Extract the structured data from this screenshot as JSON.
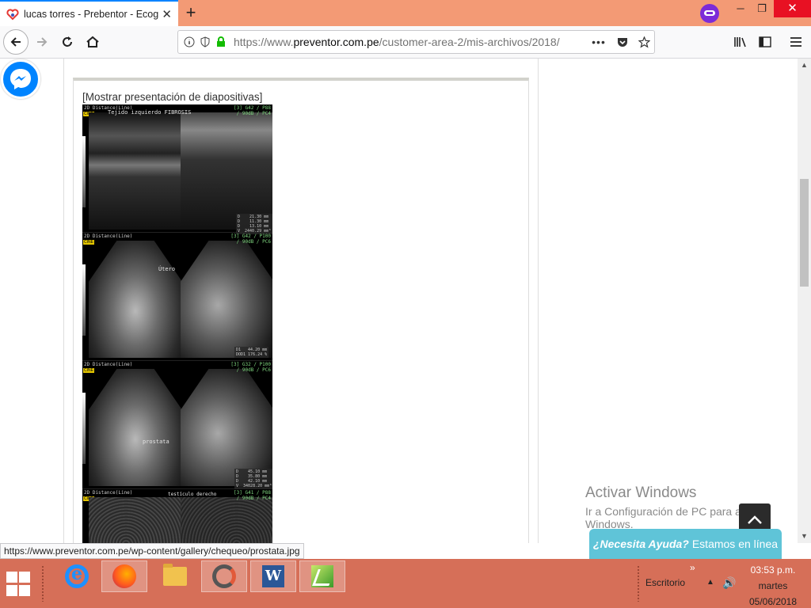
{
  "browser": {
    "tab": {
      "title": "lucas torres - Prebentor - Ecogr"
    },
    "url": {
      "prefix": "https://www.",
      "host": "preventor.com.pe",
      "path": "/customer-area-2/mis-archivos/2018/"
    },
    "window": {
      "minimize": "─",
      "restore": "❐",
      "close": "✕"
    }
  },
  "page": {
    "slideshow_link": "[Mostrar presentación de diapositivas]",
    "ultrasound": {
      "panels": [
        {
          "header": "2D Distance(Line)",
          "label": "Tejido izquierdo FIBROSIS",
          "mode": "[3] G42 / P88\n/ 90dB / PC4",
          "meas": "D    21.30 mm\nD    11.30 mm\nD    13.10 mm\nV  2440.29 mm³"
        },
        {
          "header": "2D Distance(Line)",
          "label": "Útero",
          "mode": "[3] G42 / P100\n/ 90dB / PC6",
          "meas": "D1   44.20 mm\nDOD1 176.24 %"
        },
        {
          "header": "2D Distance(Line)",
          "label": "prostata",
          "mode": "[3] G32 / P100\n/ 90dB / PC6",
          "meas": "D    45.10 mm\nD    35.80 mm\nD    42.10 mm\nV  34028.20 mm³"
        },
        {
          "header": "2D Distance(Line)",
          "label": "testículo derecho",
          "mode": "[3] G41 / P88\n/ 90dB / PC4",
          "meas": ""
        }
      ],
      "cine_label": "CINE"
    },
    "activate_windows": {
      "title": "Activar Windows",
      "subtitle": "Ir a Configuración de PC para activar Windows."
    },
    "help_chat": {
      "strong": "¿Necesita Ayuda?",
      "rest": "Estamos en línea"
    },
    "status_url": "https://www.preventor.com.pe/wp-content/gallery/chequeo/prostata.jpg"
  },
  "taskbar": {
    "desktop_label": "Escritorio",
    "clock": {
      "time": "03:53 p.m.",
      "day": "martes",
      "date": "05/06/2018"
    }
  }
}
